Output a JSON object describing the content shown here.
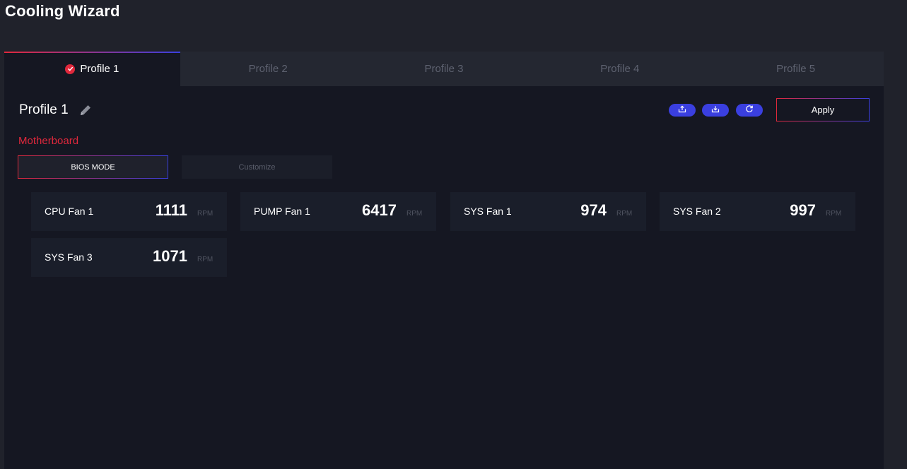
{
  "app": {
    "title": "Cooling Wizard"
  },
  "tabs": [
    {
      "label": "Profile 1",
      "active": true
    },
    {
      "label": "Profile 2",
      "active": false
    },
    {
      "label": "Profile 3",
      "active": false
    },
    {
      "label": "Profile 4",
      "active": false
    },
    {
      "label": "Profile 5",
      "active": false
    }
  ],
  "profile": {
    "name": "Profile 1"
  },
  "toolbar": {
    "icons": [
      "export-icon",
      "import-icon",
      "reset-icon"
    ],
    "apply_label": "Apply"
  },
  "section": {
    "label": "Motherboard"
  },
  "modes": {
    "bios_label": "BIOS MODE",
    "customize_label": "Customize",
    "selected": "BIOS MODE"
  },
  "fans": [
    {
      "name": "CPU Fan 1",
      "value": "1111",
      "unit": "RPM"
    },
    {
      "name": "PUMP Fan 1",
      "value": "6417",
      "unit": "RPM"
    },
    {
      "name": "SYS Fan 1",
      "value": "974",
      "unit": "RPM"
    },
    {
      "name": "SYS Fan 2",
      "value": "997",
      "unit": "RPM"
    },
    {
      "name": "SYS Fan 3",
      "value": "1071",
      "unit": "RPM"
    }
  ],
  "colors": {
    "accent_red": "#e0283c",
    "accent_blue": "#3a3fe0",
    "background": "#20222b",
    "panel": "#151722"
  }
}
